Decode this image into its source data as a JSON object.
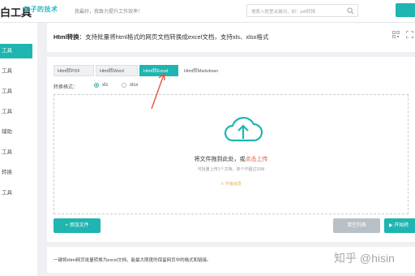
{
  "header": {
    "logo_text": "白工具",
    "logo_sub": "包子的技术",
    "slogan": "我最好，我致力提升工作效率！",
    "search_placeholder": "搜索入框里关键词，如：pdf转换"
  },
  "sidebar": {
    "items": [
      {
        "label": "工具",
        "active": true
      },
      {
        "label": "工具",
        "active": false
      },
      {
        "label": "工具",
        "active": false
      },
      {
        "label": "工具",
        "active": false
      },
      {
        "label": "辅助",
        "active": false
      },
      {
        "label": "工具",
        "active": false
      },
      {
        "label": "转换",
        "active": false
      },
      {
        "label": "工具",
        "active": false
      }
    ]
  },
  "card": {
    "title_bold": "Html转换",
    "title_rest": "：支持批量将html格式的网页文档转换成excel文档，支持xls、xlsx格式"
  },
  "tabs": [
    {
      "label": "Html转PDF",
      "active": false
    },
    {
      "label": "Html转Word",
      "active": false
    },
    {
      "label": "Html转Excel",
      "active": true
    },
    {
      "label": "Html转Markdown",
      "active": false
    }
  ],
  "format": {
    "label": "转换格式：",
    "options": [
      {
        "label": "xls",
        "selected": true
      },
      {
        "label": "xlsx",
        "selected": false
      }
    ]
  },
  "drop": {
    "main_text": "将文件拖到此处，或",
    "main_link": "点击上传",
    "sub_text": "可批量上传1个文档，单个不超过10M",
    "vip_text": "升级会员"
  },
  "buttons": {
    "add": "+ 添加文件",
    "clear": "清空列表",
    "start": "▶ 开始转"
  },
  "footer": {
    "text": "一键将Html网页批量转换为excel文档，能最大限度的保留网页中的格式和链接。"
  },
  "watermark": "知乎 @hisin",
  "colors": {
    "accent": "#1fb5b0",
    "annotation": "#e6513b"
  }
}
